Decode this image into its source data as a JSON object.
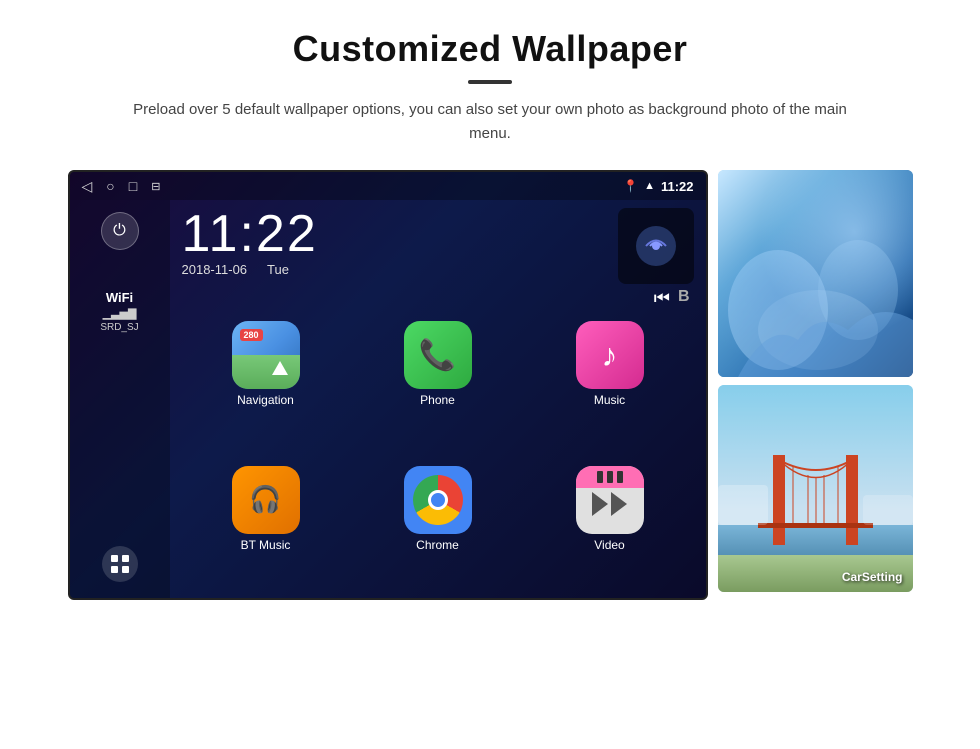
{
  "header": {
    "title": "Customized Wallpaper",
    "subtitle": "Preload over 5 default wallpaper options, you can also set your own photo as background photo of the main menu."
  },
  "android": {
    "status_bar": {
      "time": "11:22",
      "back_icon": "◁",
      "home_icon": "○",
      "recent_icon": "□",
      "screenshot_icon": "⊟"
    },
    "clock": {
      "time": "11:22",
      "date": "2018-11-06",
      "day": "Tue"
    },
    "sidebar": {
      "wifi_label": "WiFi",
      "wifi_ssid": "SRD_SJ"
    },
    "apps": [
      {
        "label": "Navigation",
        "icon_type": "nav"
      },
      {
        "label": "Phone",
        "icon_type": "phone"
      },
      {
        "label": "Music",
        "icon_type": "music"
      },
      {
        "label": "BT Music",
        "icon_type": "bt"
      },
      {
        "label": "Chrome",
        "icon_type": "chrome"
      },
      {
        "label": "Video",
        "icon_type": "video"
      }
    ]
  },
  "wallpapers": [
    {
      "type": "ice",
      "label": ""
    },
    {
      "type": "bridge",
      "label": "CarSetting"
    }
  ]
}
